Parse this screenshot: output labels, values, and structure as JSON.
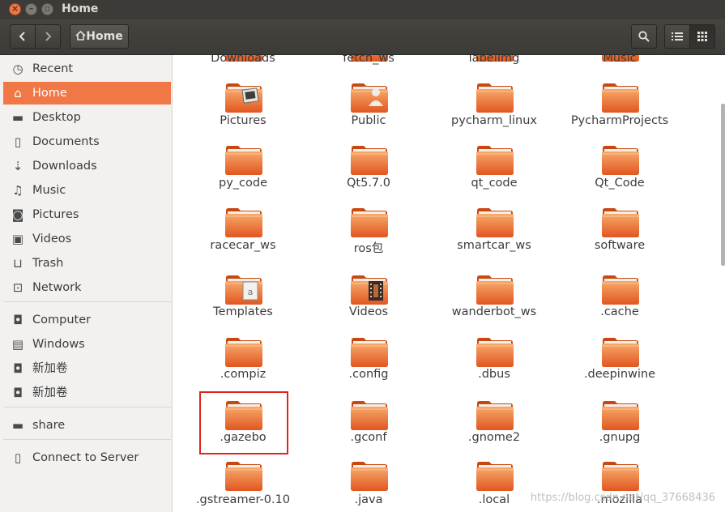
{
  "window": {
    "title": "Home"
  },
  "toolbar": {
    "breadcrumb": "Home",
    "back_glyph": "‹",
    "forward_glyph": "›"
  },
  "sidebar": {
    "items": [
      {
        "label": "Recent",
        "icon": "clock-icon",
        "glyph": "◷",
        "active": false
      },
      {
        "label": "Home",
        "icon": "home-icon",
        "glyph": "⌂",
        "active": true
      },
      {
        "label": "Desktop",
        "icon": "folder-icon",
        "glyph": "▬",
        "active": false
      },
      {
        "label": "Documents",
        "icon": "document-icon",
        "glyph": "▯",
        "active": false
      },
      {
        "label": "Downloads",
        "icon": "download-icon",
        "glyph": "⇣",
        "active": false
      },
      {
        "label": "Music",
        "icon": "music-icon",
        "glyph": "♫",
        "active": false
      },
      {
        "label": "Pictures",
        "icon": "camera-icon",
        "glyph": "◙",
        "active": false
      },
      {
        "label": "Videos",
        "icon": "video-icon",
        "glyph": "▣",
        "active": false
      },
      {
        "label": "Trash",
        "icon": "trash-icon",
        "glyph": "⊔",
        "active": false
      },
      {
        "label": "Network",
        "icon": "network-icon",
        "glyph": "⊡",
        "active": false
      },
      {
        "label": "Computer",
        "icon": "drive-icon",
        "glyph": "◘",
        "active": false
      },
      {
        "label": "Windows",
        "icon": "drive-icon",
        "glyph": "▤",
        "active": false
      },
      {
        "label": "新加卷",
        "icon": "drive-icon",
        "glyph": "◘",
        "active": false
      },
      {
        "label": "新加卷",
        "icon": "drive-icon",
        "glyph": "◘",
        "active": false
      },
      {
        "label": "share",
        "icon": "folder-icon",
        "glyph": "▬",
        "active": false
      },
      {
        "label": "Connect to Server",
        "icon": "server-icon",
        "glyph": "▯",
        "active": false
      }
    ]
  },
  "files": {
    "rows": [
      [
        {
          "name": "Downloads",
          "overlay": ""
        },
        {
          "name": "fetch_ws",
          "overlay": ""
        },
        {
          "name": "labelImg",
          "overlay": ""
        },
        {
          "name": "Music",
          "overlay": ""
        }
      ],
      [
        {
          "name": "Pictures",
          "overlay": "pictures"
        },
        {
          "name": "Public",
          "overlay": "public"
        },
        {
          "name": "pycharm_linux",
          "overlay": ""
        },
        {
          "name": "PycharmProjects",
          "overlay": ""
        }
      ],
      [
        {
          "name": "py_code",
          "overlay": ""
        },
        {
          "name": "Qt5.7.0",
          "overlay": ""
        },
        {
          "name": "qt_code",
          "overlay": ""
        },
        {
          "name": "Qt_Code",
          "overlay": ""
        }
      ],
      [
        {
          "name": "racecar_ws",
          "overlay": ""
        },
        {
          "name": "ros包",
          "overlay": ""
        },
        {
          "name": "smartcar_ws",
          "overlay": ""
        },
        {
          "name": "software",
          "overlay": ""
        }
      ],
      [
        {
          "name": "Templates",
          "overlay": "templates"
        },
        {
          "name": "Videos",
          "overlay": "videos"
        },
        {
          "name": "wanderbot_ws",
          "overlay": ""
        },
        {
          "name": ".cache",
          "overlay": ""
        }
      ],
      [
        {
          "name": ".compiz",
          "overlay": ""
        },
        {
          "name": ".config",
          "overlay": ""
        },
        {
          "name": ".dbus",
          "overlay": ""
        },
        {
          "name": ".deepinwine",
          "overlay": ""
        }
      ],
      [
        {
          "name": ".gazebo",
          "overlay": ""
        },
        {
          "name": ".gconf",
          "overlay": ""
        },
        {
          "name": ".gnome2",
          "overlay": ""
        },
        {
          "name": ".gnupg",
          "overlay": ""
        }
      ],
      [
        {
          "name": ".gstreamer-0.10",
          "overlay": ""
        },
        {
          "name": ".java",
          "overlay": ""
        },
        {
          "name": ".local",
          "overlay": ""
        },
        {
          "name": ".mozilla",
          "overlay": ""
        }
      ]
    ],
    "highlighted": ".gazebo"
  },
  "watermark": "https://blog.csdn.net/qq_37668436",
  "colors": {
    "accent": "#f07746",
    "folder_light": "#f6a567",
    "folder_dark": "#e0521f",
    "highlight_border": "#e0241d"
  }
}
